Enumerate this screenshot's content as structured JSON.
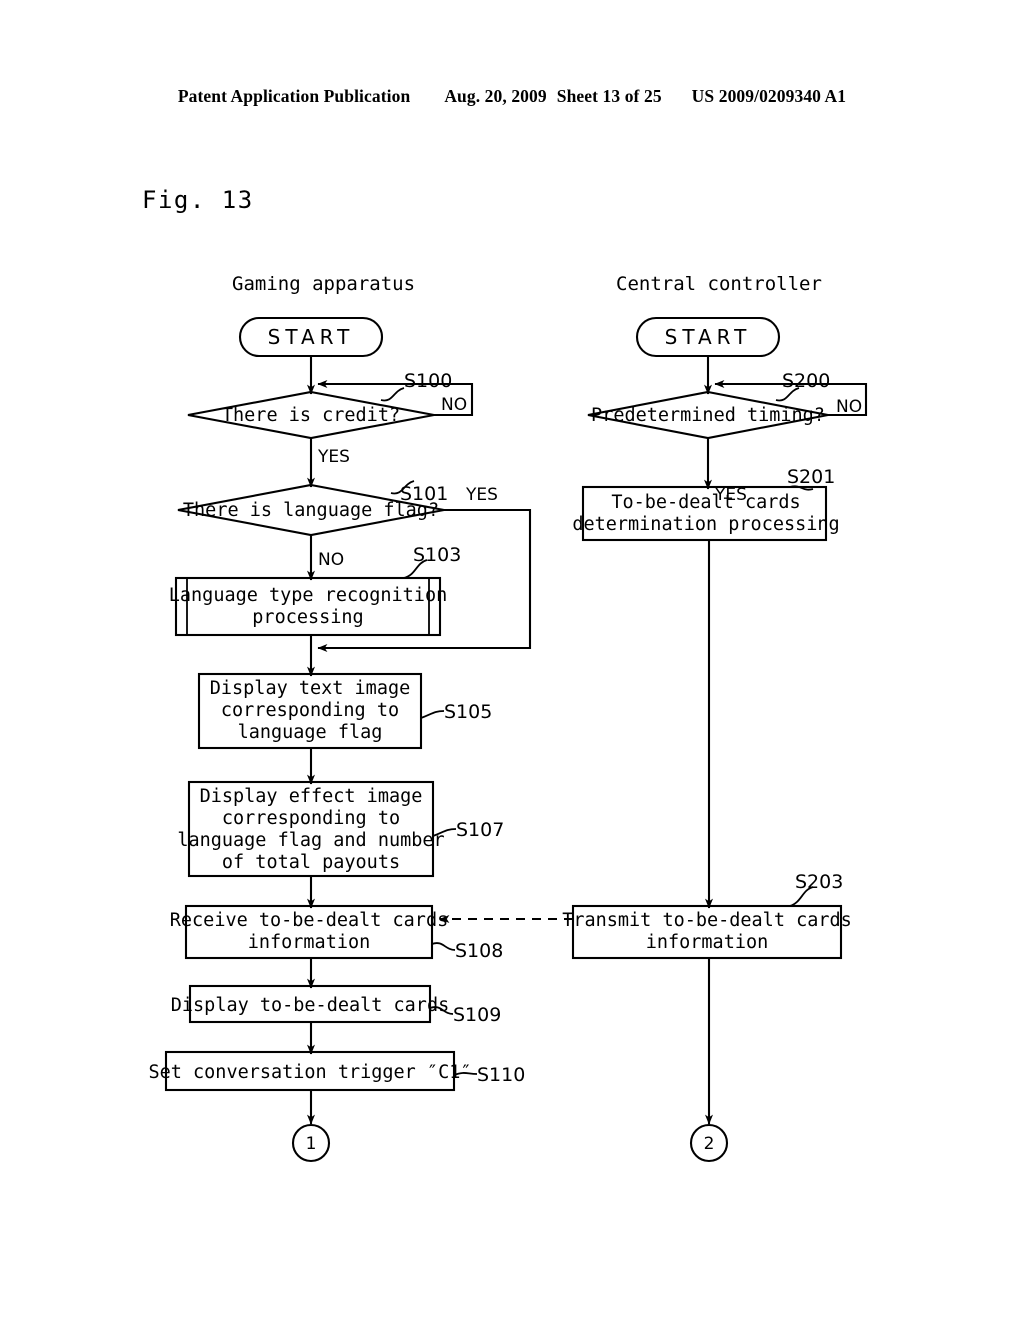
{
  "header": {
    "publication": "Patent Application Publication",
    "date": "Aug. 20, 2009",
    "sheet": "Sheet 13 of 25",
    "patent_number": "US 2009/0209340 A1"
  },
  "figure": {
    "label": "Fig. 13"
  },
  "columns": [
    {
      "title": "Gaming apparatus"
    },
    {
      "title": "Central controller"
    }
  ],
  "left_column": {
    "start_label": "START",
    "nodes": [
      {
        "step": "S100",
        "text": [
          "There is credit?"
        ],
        "shape": "decision",
        "yes": "YES",
        "no": "NO"
      },
      {
        "step": "S101",
        "text": [
          "There is language flag?"
        ],
        "shape": "decision",
        "yes": "YES",
        "no": "NO"
      },
      {
        "step": "S103",
        "text": [
          "Language type recognition",
          "processing"
        ],
        "shape": "predefined-process"
      },
      {
        "step": "S105",
        "text": [
          "Display text image",
          "corresponding to",
          "language flag"
        ],
        "shape": "process"
      },
      {
        "step": "S107",
        "text": [
          "Display effect image",
          "corresponding to",
          "language flag and number",
          "of total payouts"
        ],
        "shape": "process"
      },
      {
        "step": "S108",
        "text": [
          "Receive to-be-dealt cards",
          "information"
        ],
        "shape": "process"
      },
      {
        "step": "S109",
        "text": [
          "Display to-be-dealt cards"
        ],
        "shape": "process"
      },
      {
        "step": "S110",
        "text": [
          "Set conversation trigger ″C1″"
        ],
        "shape": "process"
      }
    ],
    "connector": "1"
  },
  "right_column": {
    "start_label": "START",
    "nodes": [
      {
        "step": "S200",
        "text": [
          "Predetermined timing?"
        ],
        "shape": "decision",
        "yes": "YES",
        "no": "NO"
      },
      {
        "step": "S201",
        "text": [
          "To-be-dealt cards",
          "determination processing"
        ],
        "shape": "process"
      },
      {
        "step": "S203",
        "text": [
          "Transmit to-be-dealt cards",
          "information"
        ],
        "shape": "process"
      }
    ],
    "connector": "2"
  },
  "colors": {
    "ink": "#000000",
    "paper": "#ffffff"
  }
}
